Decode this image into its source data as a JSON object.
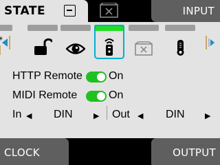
{
  "header": {
    "state_label": "STATE",
    "input_label": "INPUT",
    "collapse_icon": "collapse-icon",
    "center_icon": "settings-window-icon"
  },
  "strip": {
    "active_tile": "http-remote",
    "tiles": [
      {
        "id": "pin",
        "icon": "pin-icon"
      },
      {
        "id": "lock",
        "icon": "unlock-icon"
      },
      {
        "id": "visibility",
        "icon": "eye-icon"
      },
      {
        "id": "http-remote",
        "icon": "remote-control-icon"
      },
      {
        "id": "window",
        "icon": "settings-window-icon"
      },
      {
        "id": "temperature",
        "icon": "thermometer-icon"
      }
    ]
  },
  "settings": {
    "http_remote": {
      "label": "HTTP Remote",
      "value": "On",
      "enabled": true
    },
    "midi_remote": {
      "label": "MIDI Remote",
      "value": "On",
      "enabled": true
    },
    "midi_in": {
      "label": "In",
      "value": "DIN"
    },
    "midi_out": {
      "label": "Out",
      "value": "DIN"
    }
  },
  "footer": {
    "clock_label": "CLOCK",
    "output_label": "OUTPUT"
  },
  "colors": {
    "panel_bg": "#e3e3e3",
    "tab_dark": "#5f5f5f",
    "active_green": "#22dd22",
    "toggle_green": "#20c020",
    "select_blue": "#00aed1",
    "cursor_blue": "#1e8fc8"
  }
}
